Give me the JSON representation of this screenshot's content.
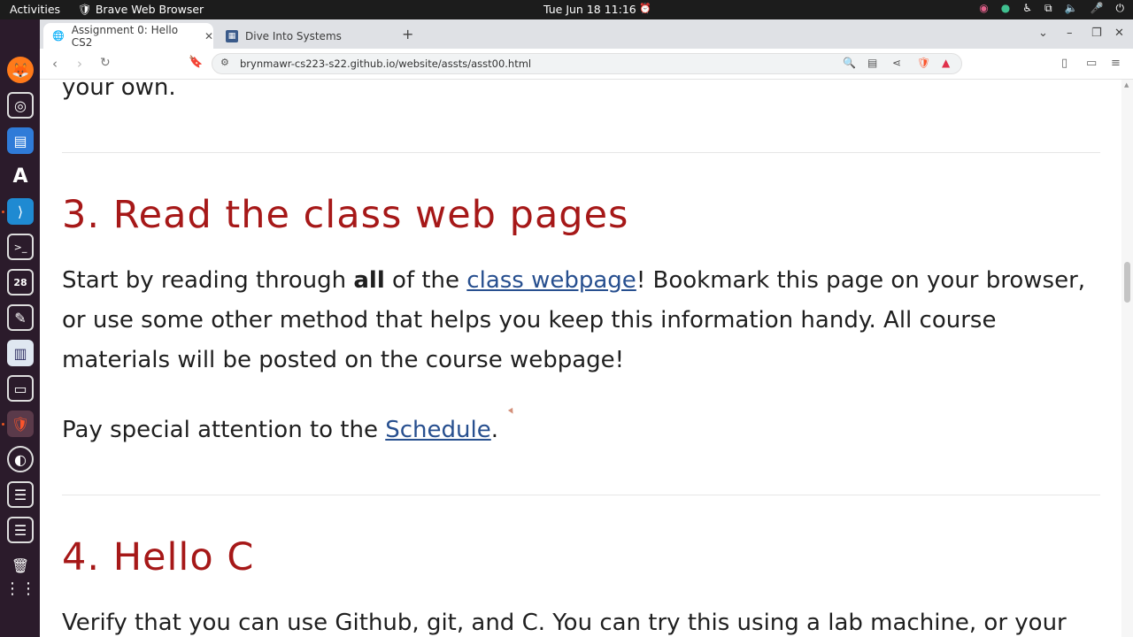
{
  "topbar": {
    "activities": "Activities",
    "app_name": "Brave Web Browser",
    "clock": "Tue Jun 18  11:16",
    "tray_icons": [
      "record-icon",
      "circle-icon",
      "accessibility-icon",
      "network-icon",
      "volume-icon",
      "mic-icon",
      "power-icon"
    ]
  },
  "dock": {
    "items": [
      "firefox-icon",
      "settings-icon",
      "document-icon",
      "fonts-icon",
      "vscode-icon",
      "terminal-icon",
      "calendar-icon",
      "editor-icon",
      "notes-icon",
      "files-icon",
      "brave-icon",
      "obs-icon",
      "storage-icon",
      "storage2-icon",
      "trash-icon",
      "apps-grid-icon"
    ]
  },
  "tabs": [
    {
      "title": "Assignment 0: Hello CS2",
      "active": true,
      "favicon": "globe-icon"
    },
    {
      "title": "Dive Into Systems",
      "active": false,
      "favicon": "book-icon"
    }
  ],
  "toolbar": {
    "url": "brynmawr-cs223-s22.github.io/website/assts/asst00.html"
  },
  "page": {
    "prev_text": "your own.",
    "section3": {
      "heading": "3. Read the class web pages",
      "p1_a": "Start by reading through ",
      "p1_bold": "all",
      "p1_b": " of the ",
      "p1_link": "class webpage",
      "p1_c": "! Bookmark this page on your browser, or use some other method that helps you keep this information handy. All course materials will be posted on the course webpage!",
      "p2_a": "Pay special attention to the ",
      "p2_link": "Schedule",
      "p2_b": "."
    },
    "section4": {
      "heading": "4. Hello C",
      "p1": "Verify that you can use Github, git, and C. You can try this using a lab machine, or your"
    }
  },
  "colors": {
    "heading": "#a61818",
    "link": "#274f8f",
    "dock_bg": "#2b1b2b",
    "topbar_bg": "#1c1c1c"
  }
}
